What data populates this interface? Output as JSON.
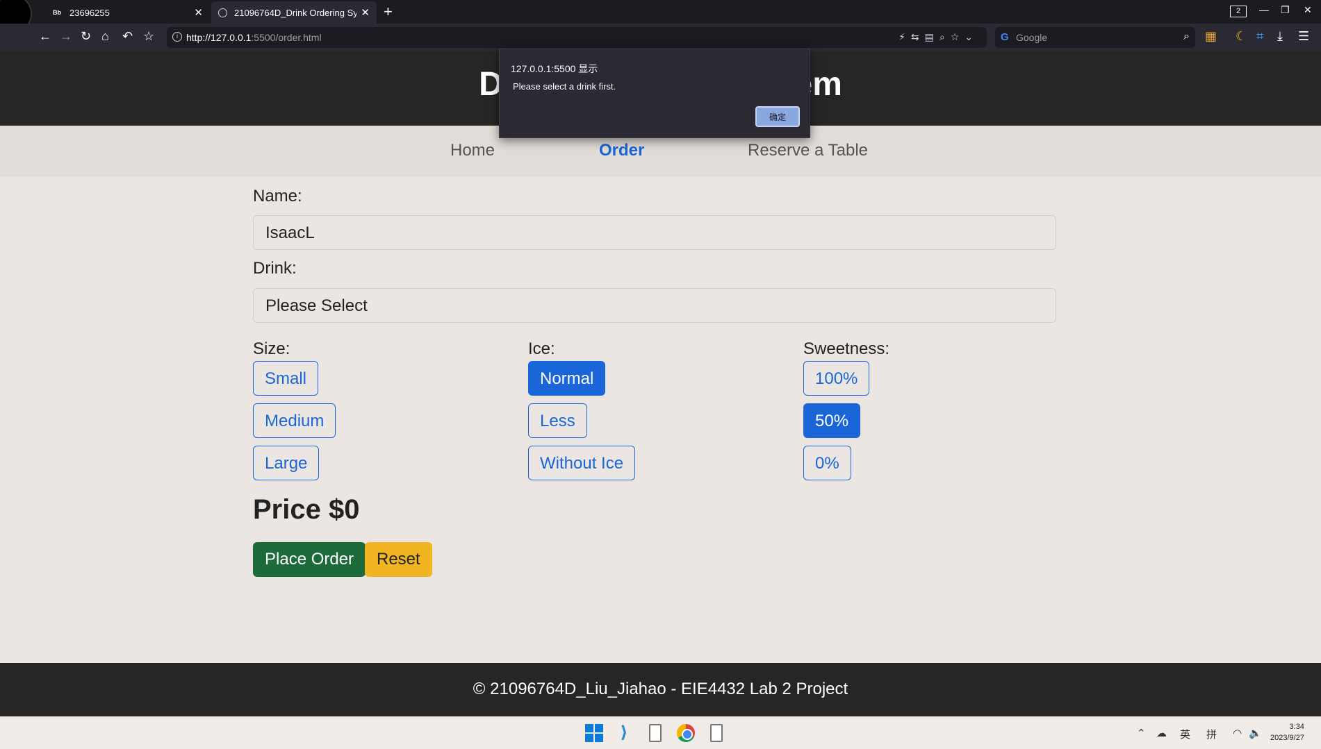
{
  "browser": {
    "tabs": [
      {
        "favicon": "Bb",
        "title": "23696255"
      },
      {
        "favicon": "globe-icon",
        "title": "21096764D_Drink Ordering Sy"
      }
    ],
    "tab_count": "2",
    "url_host": "http://127.0.0.1",
    "url_rest": ":5500/order.html",
    "search_placeholder": "Google"
  },
  "site": {
    "title": "Drink Ordering System",
    "nav": [
      {
        "label": "Home",
        "active": false
      },
      {
        "label": "Order",
        "active": true
      },
      {
        "label": "Reserve a Table",
        "active": false
      }
    ],
    "footer": "© 21096764D_Liu_Jiahao - EIE4432 Lab 2 Project"
  },
  "form": {
    "name_label": "Name:",
    "name_value": "IsaacL",
    "drink_label": "Drink:",
    "drink_value": "Please Select",
    "size_label": "Size:",
    "sizes": [
      "Small",
      "Medium",
      "Large"
    ],
    "ice_label": "Ice:",
    "ice_options": [
      "Normal",
      "Less",
      "Without Ice"
    ],
    "ice_selected": "Normal",
    "sweet_label": "Sweetness:",
    "sweet_options": [
      "100%",
      "50%",
      "0%"
    ],
    "sweet_selected": "50%",
    "price": "Price $0",
    "place_order": "Place Order",
    "reset": "Reset"
  },
  "dialog": {
    "origin": "127.0.0.1:5500 显示",
    "message": "Please select a drink first.",
    "ok": "确定"
  },
  "taskbar": {
    "tray_lang": "英",
    "tray_ime": "拼",
    "time": "3:34",
    "date": "2023/9/27"
  },
  "colors": {
    "primary": "#1a66d9",
    "success": "#1d6b3a",
    "warning": "#f0b520",
    "header_bg": "#282625"
  }
}
